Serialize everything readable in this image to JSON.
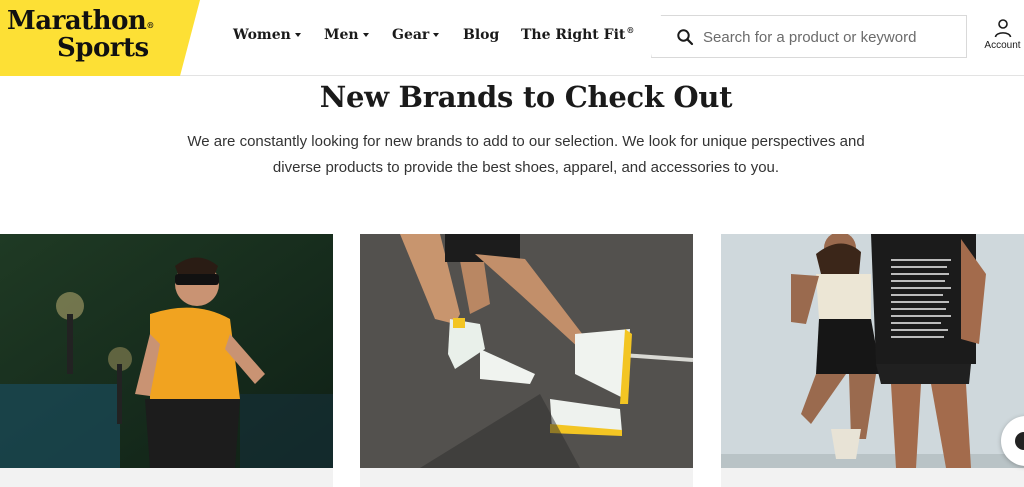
{
  "brand": {
    "line1": "Marathon",
    "line2": "Sports",
    "reg_mark": "®",
    "color": "#fde035"
  },
  "nav": {
    "women": "Women",
    "men": "Men",
    "gear": "Gear",
    "blog": "Blog",
    "right_fit": "The Right Fit",
    "right_fit_mark": "®"
  },
  "search": {
    "placeholder": "Search for a product or keyword",
    "value": "",
    "icon": "search-icon"
  },
  "account": {
    "label": "Account",
    "icon": "user-icon"
  },
  "main": {
    "title": "New Brands to Check Out",
    "description": "We are constantly looking for new brands to add to our selection. We look for unique perspectives and diverse products to provide the best shoes, apparel, and accessories to you."
  },
  "cards": [
    {
      "image": "runner in orange shirt"
    },
    {
      "image": "runners in white and yellow shoes"
    },
    {
      "image": "two people in athletic wear"
    }
  ],
  "chat": {
    "icon": "chat-icon"
  }
}
